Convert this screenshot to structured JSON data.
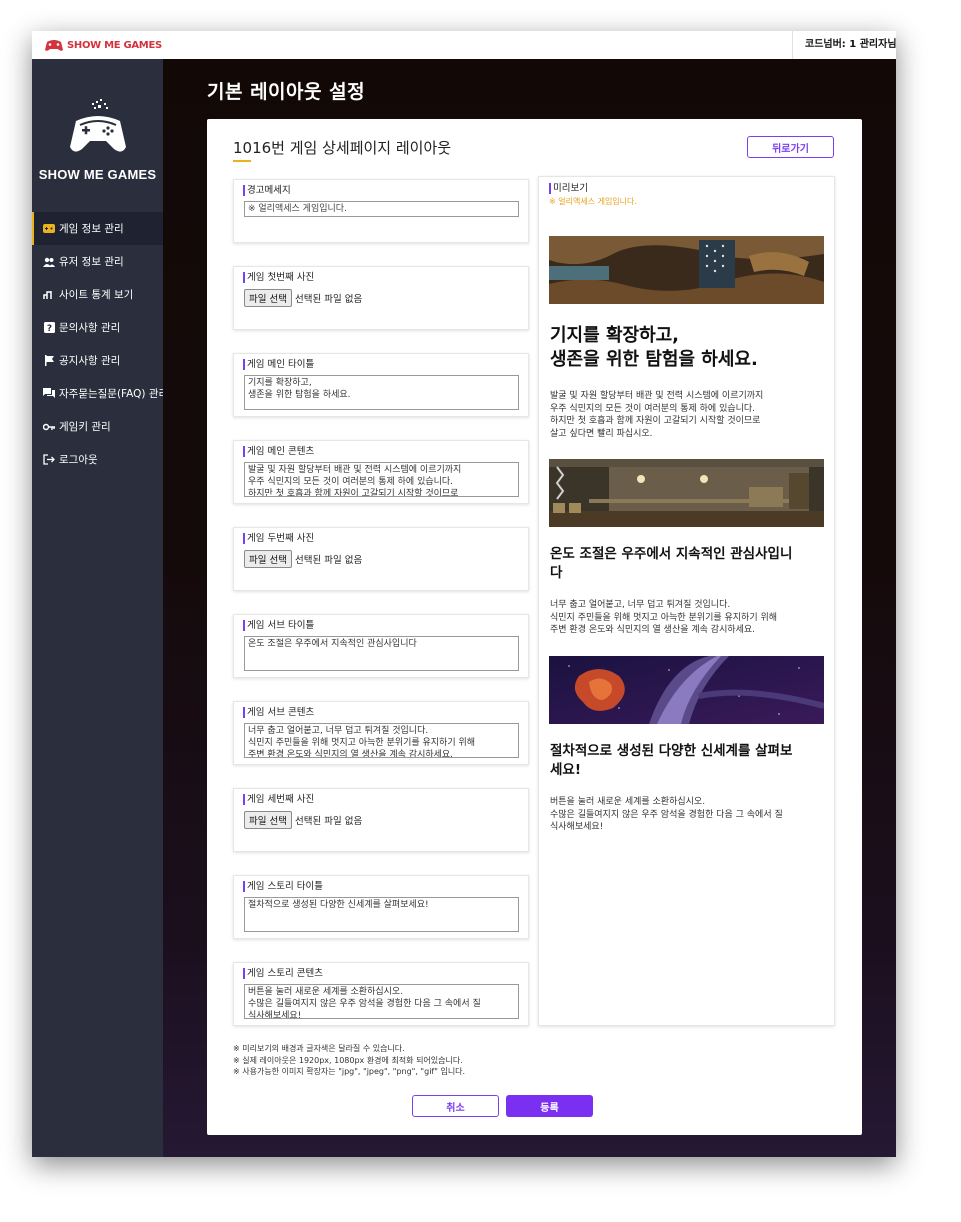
{
  "topbar": {
    "brand": "SHOW ME GAMES",
    "user_info": "코드넘버: 1  관리자님"
  },
  "sidebar": {
    "logo_text": "SHOW ME GAMES",
    "items": [
      {
        "label": "게임 정보 관리",
        "icon": "gamepad-icon",
        "active": true
      },
      {
        "label": "유저 정보 관리",
        "icon": "users-icon"
      },
      {
        "label": "사이트 통계 보기",
        "icon": "chart-icon"
      },
      {
        "label": "문의사항 관리",
        "icon": "question-icon"
      },
      {
        "label": "공지사항 관리",
        "icon": "flag-icon"
      },
      {
        "label": "자주묻는질문(FAQ) 관리",
        "icon": "chat-icon"
      },
      {
        "label": "게임키 관리",
        "icon": "key-icon"
      },
      {
        "label": "로그아웃",
        "icon": "logout-icon"
      }
    ]
  },
  "page": {
    "title": "기본 레이아웃 설정"
  },
  "card": {
    "title": "1016번 게임 상세페이지 레이아웃",
    "back_label": "뒤로가기"
  },
  "form": {
    "warning": {
      "label": "경고메세지",
      "value": "※ 얼리액세스 게임입니다."
    },
    "image1": {
      "label": "게임 첫번째 사진",
      "button": "파일 선택",
      "status": "선택된 파일 없음"
    },
    "main_title": {
      "label": "게임 메인 타이틀",
      "lines": [
        "기지를 확장하고,",
        "생존을 위한 탐험을 하세요."
      ]
    },
    "main_content": {
      "label": "게임 메인 콘텐츠",
      "lines": [
        "발굴 및 자원 할당부터 배관 및 전력 시스템에 이르기까지",
        " 우주 식민지의 모든 것이 여러분의 통제 하에 있습니다.",
        "하지만 첫 호흡과 함께 자원이 고갈되기 시작할 것이므로"
      ]
    },
    "image2": {
      "label": "게임 두번째 사진",
      "button": "파일 선택",
      "status": "선택된 파일 없음"
    },
    "sub_title": {
      "label": "게임 서브 타이틀",
      "lines": [
        "온도 조절은 우주에서 지속적인 관심사입니다"
      ]
    },
    "sub_content": {
      "label": "게임 서브 콘텐츠",
      "lines": [
        "너무 춥고 얼어붙고, 너무 덥고 튀겨질 것입니다.",
        "식민지 주민들을 위해 멋지고 아늑한 분위기를 유지하기 위해",
        "주변 환경 온도와 식민지의 열 생산을 계속 감시하세요."
      ]
    },
    "image3": {
      "label": "게임 세번째 사진",
      "button": "파일 선택",
      "status": "선택된 파일 없음"
    },
    "story_title": {
      "label": "게임 스토리 타이틀",
      "lines": [
        "절차적으로 생성된 다양한 신세계를 살펴보세요!"
      ]
    },
    "story_content": {
      "label": "게임 스토리 콘텐츠",
      "lines": [
        "버튼을 눌러 새로운 세계를 소환하십시오.",
        "수많은 길들여지지 않은 우주 암석을 경험한 다음 그 속에서 질",
        "식사해보세요!"
      ]
    }
  },
  "preview": {
    "label": "미리보기",
    "warning": "※ 얼리액세스 게임입니다.",
    "main_title": [
      "기지를 확장하고,",
      "생존을 위한 탐험을 하세요."
    ],
    "main_content": [
      "발굴 및 자원 할당부터 배관 및 전력 시스템에 이르기까지",
      "우주 식민지의 모든 것이 여러분의 통제 하에 있습니다.",
      "하지만 첫 호흡과 함께 자원이 고갈되기 시작할 것이므로",
      "살고 싶다면 빨리 파십시오."
    ],
    "sub_title": [
      "온도 조절은 우주에서 지속적인 관심사입니",
      "다"
    ],
    "sub_content": [
      "너무 춥고 얼어붙고, 너무 덥고 튀겨질 것입니다.",
      "식민지 주민들을 위해 멋지고 아늑한 분위기를 유지하기 위해",
      "주변 환경 온도와 식민지의 열 생산을 계속 감시하세요."
    ],
    "story_title": [
      "절차적으로 생성된 다양한 신세계를 살펴보",
      "세요!"
    ],
    "story_content": [
      "버튼을 눌러 새로운 세계를 소환하십시오.",
      "수많은 길들여지지 않은 우주 암석을 경험한 다음 그 속에서 질",
      "식사해보세요!"
    ]
  },
  "notes": [
    "※ 미리보기의 배경과 글자색은 달라질 수 있습니다.",
    "※ 실제 레이아웃은 1920px, 1080px 환경에 최적화 되어있습니다.",
    "※ 사용가능한 이미지 확장자는 \"jpg\", \"jpeg\", \"png\", \"gif\" 입니다."
  ],
  "buttons": {
    "cancel": "취소",
    "submit": "등록"
  },
  "colors": {
    "accent": "#7b2ff0",
    "highlight": "#e8b31c",
    "sidebar": "#2b2f3d",
    "brand": "#d4323d"
  }
}
